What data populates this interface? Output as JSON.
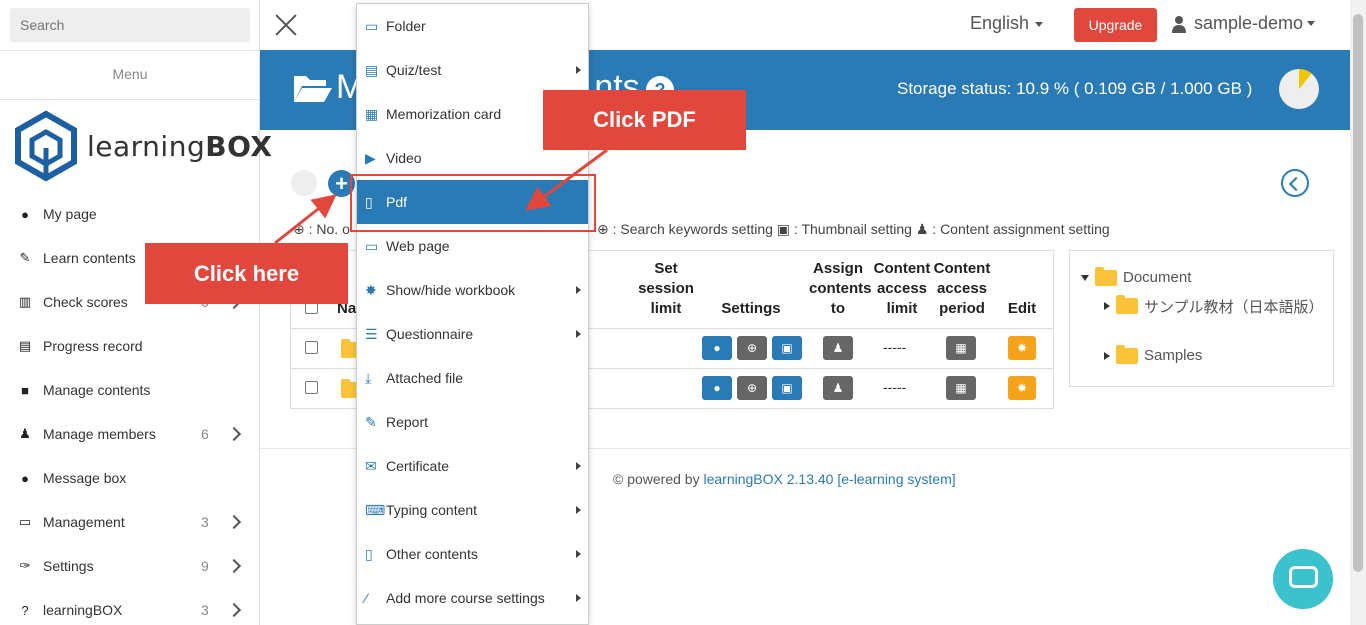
{
  "sidebar": {
    "search_placeholder": "Search",
    "menu_title": "Menu",
    "logo_text_bold": "BOX",
    "logo_text_light": "learning",
    "items": [
      {
        "label": "My page",
        "icon": "user-icon",
        "count": "",
        "has_chevron": false
      },
      {
        "label": "Learn contents",
        "icon": "pencil-icon",
        "count": "",
        "has_chevron": false
      },
      {
        "label": "Check scores",
        "icon": "bar-chart-icon",
        "count": "6",
        "has_chevron": true
      },
      {
        "label": "Progress record",
        "icon": "line-chart-icon",
        "count": "",
        "has_chevron": false
      },
      {
        "label": "Manage contents",
        "icon": "folder-icon",
        "count": "",
        "has_chevron": false
      },
      {
        "label": "Manage members",
        "icon": "users-icon",
        "count": "6",
        "has_chevron": true
      },
      {
        "label": "Message box",
        "icon": "comments-icon",
        "count": "",
        "has_chevron": false
      },
      {
        "label": "Management",
        "icon": "monitor-icon",
        "count": "3",
        "has_chevron": true
      },
      {
        "label": "Settings",
        "icon": "wrench-icon",
        "count": "9",
        "has_chevron": true
      },
      {
        "label": "learningBOX",
        "icon": "question-icon",
        "count": "3",
        "has_chevron": true
      }
    ]
  },
  "header": {
    "language": "English",
    "upgrade_label": "Upgrade",
    "username": "sample-demo"
  },
  "banner": {
    "title": "M",
    "title_tail": "nts",
    "storage_text": "Storage status: 10.9 % ( 0.109 GB / 1.000 GB )",
    "storage_percent": 10.9,
    "colors": {
      "banner": "#2a7ab5",
      "pie_used": "#f2c400",
      "pie_free": "#eeeeee"
    }
  },
  "legend": {
    "left": "⊕ : No. o",
    "right": ": Search keywords setting    ▣ : Thumbnail setting    ♟ : Content assignment setting"
  },
  "table": {
    "headers": {
      "name": "Na",
      "session": "Set session limit",
      "settings": "Settings",
      "assign": "Assign contents to",
      "access_limit": "Content access limit",
      "access_period": "Content access period",
      "edit": "Edit"
    },
    "rows": [
      {
        "access_limit": "-----"
      },
      {
        "access_limit": "-----"
      }
    ]
  },
  "tree": {
    "root": "Document",
    "children": [
      "サンプル教材（日本語版）",
      "Samples"
    ]
  },
  "footer": {
    "prefix": "© powered by ",
    "link": "learningBOX 2.13.40 [e-learning system]"
  },
  "dropdown": {
    "items": [
      {
        "label": "Folder",
        "icon": "folder-outline-icon",
        "submenu": false,
        "active": false
      },
      {
        "label": "Quiz/test",
        "icon": "quiz-icon",
        "submenu": true,
        "active": false
      },
      {
        "label": "Memorization card",
        "icon": "card-icon",
        "submenu": false,
        "active": false
      },
      {
        "label": "Video",
        "icon": "video-file-icon",
        "submenu": false,
        "active": false
      },
      {
        "label": "Pdf",
        "icon": "pdf-file-icon",
        "submenu": false,
        "active": true
      },
      {
        "label": "Web page",
        "icon": "browser-icon",
        "submenu": false,
        "active": false
      },
      {
        "label": "Show/hide workbook",
        "icon": "gear-icon",
        "submenu": true,
        "active": false
      },
      {
        "label": "Questionnaire",
        "icon": "list-icon",
        "submenu": true,
        "active": false
      },
      {
        "label": "Attached file",
        "icon": "download-file-icon",
        "submenu": false,
        "active": false
      },
      {
        "label": "Report",
        "icon": "edit-file-icon",
        "submenu": false,
        "active": false
      },
      {
        "label": "Certificate",
        "icon": "certificate-icon",
        "submenu": true,
        "active": false
      },
      {
        "label": "Typing content",
        "icon": "keyboard-icon",
        "submenu": true,
        "active": false
      },
      {
        "label": "Other contents",
        "icon": "file-icon",
        "submenu": true,
        "active": false
      },
      {
        "label": "Add more course settings",
        "icon": "road-icon",
        "submenu": true,
        "active": false
      }
    ]
  },
  "callouts": {
    "click_pdf": "Click PDF",
    "click_here": "Click here",
    "color": "#e2473d"
  }
}
